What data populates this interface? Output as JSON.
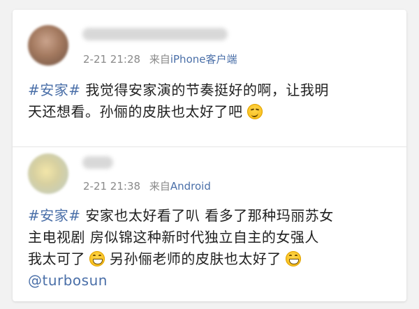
{
  "posts": [
    {
      "time": "2-21 21:28",
      "source_prefix": "来自",
      "source": "iPhone客户端",
      "lines": [
        {
          "tag": "#安家#",
          "text": " 我觉得安家演的节奏挺好的啊，让我明"
        },
        {
          "text": "天还想看。孙俪的皮肤也太好了吧",
          "emoji": "smirk-face-icon"
        }
      ]
    },
    {
      "time": "2-21 21:38",
      "source_prefix": "来自",
      "source": "Android",
      "lines": [
        {
          "tag": "#安家#",
          "text": " 安家也太好看了叭  看多了那种玛丽苏女"
        },
        {
          "text": "主电视剧  房似锦这种新时代独立自主的女强人"
        },
        {
          "text": "我太可了",
          "emoji": "grinning-face-icon",
          "text2": " 另孙俪老师的皮肤也太好了",
          "emoji2": "grinning-face-icon"
        },
        {
          "mention": "@turbosun"
        }
      ]
    }
  ],
  "colors": {
    "link": "#4a6fa8",
    "text": "#1f1f1f",
    "meta": "#8a8a8a",
    "card_bg": "#ffffff",
    "page_bg": "#f2f2f2"
  }
}
